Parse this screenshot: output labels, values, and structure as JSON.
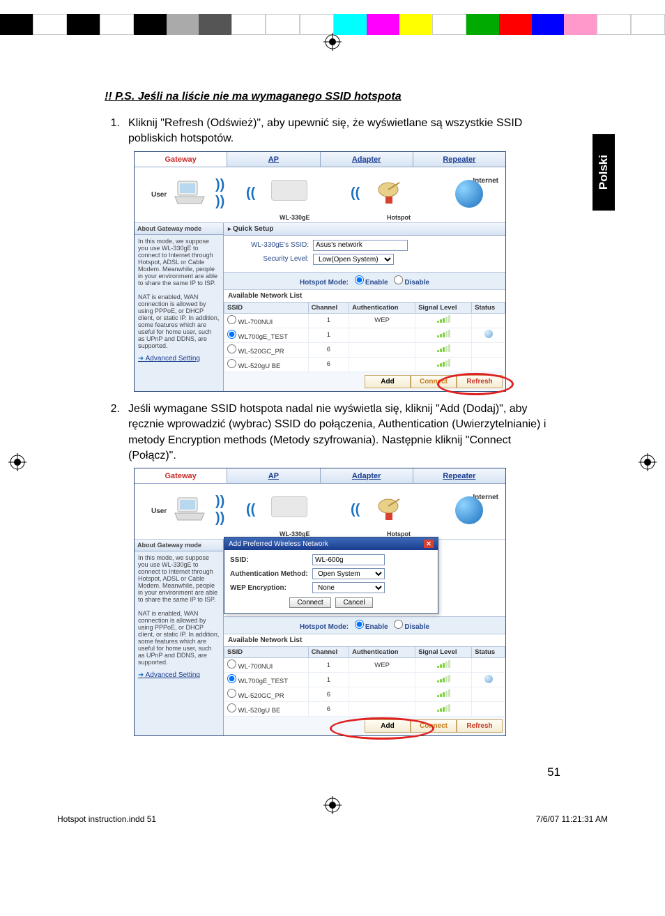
{
  "lang_tab": "Polski",
  "ps_heading": "!! P.S. Jeśli na liście nie ma wymaganego SSID hotspota",
  "steps": [
    {
      "num": "1.",
      "text": "Kliknij \"Refresh (Odśwież)\", aby upewnić się, że wyświetlane są wszystkie SSID pobliskich hotspotów."
    },
    {
      "num": "2.",
      "text": "Jeśli wymagane SSID hotspota nadal nie wyświetla się, kliknij \"Add (Dodaj)\", aby ręcznie wprowadzić (wybrac) SSID do połączenia, Authentication (Uwierzytelnianie) i metody Encryption methods (Metody szyfrowania). Następnie kliknij \"Connect (Połącz)\"."
    }
  ],
  "tabs": {
    "gateway": "Gateway",
    "ap": "AP",
    "adapter": "Adapter",
    "repeater": "Repeater"
  },
  "diagram": {
    "user": "User",
    "internet": "Internet",
    "device": "WL-330gE",
    "hotspot": "Hotspot"
  },
  "sidebar": {
    "title": "About Gateway mode",
    "text1": "In this mode, we suppose you use WL-330gE to connect to Internet through Hotspot, ADSL or Cable Modem. Meanwhile, people in your environment are able to share the same IP to ISP.",
    "text2": "NAT is enabled, WAN connection is allowed by using PPPoE, or DHCP client, or static IP. In addition, some features which are useful for home user, such as UPnP and DDNS, are supported.",
    "link": "Advanced Setting"
  },
  "quick_setup": {
    "title": "Quick Setup",
    "ssid_label": "WL-330gE's SSID:",
    "ssid_value": "Asus's network",
    "security_label": "Security Level:",
    "security_value": "Low(Open System)"
  },
  "hotspot_mode": {
    "label": "Hotspot Mode:",
    "enable": "Enable",
    "disable": "Disable"
  },
  "network_list": {
    "title": "Available Network List",
    "headers": {
      "ssid": "SSID",
      "channel": "Channel",
      "auth": "Authentication",
      "signal": "Signal Level",
      "status": "Status"
    },
    "rows": [
      {
        "ssid": "WL-700NUI",
        "channel": "1",
        "auth": "WEP",
        "selected": false,
        "status": false
      },
      {
        "ssid": "WL700gE_TEST",
        "channel": "1",
        "auth": "",
        "selected": true,
        "status": true
      },
      {
        "ssid": "WL-520GC_PR",
        "channel": "6",
        "auth": "",
        "selected": false,
        "status": false
      },
      {
        "ssid": "WL-520gU BE",
        "channel": "6",
        "auth": "",
        "selected": false,
        "status": false
      }
    ]
  },
  "buttons": {
    "add": "Add",
    "connect": "Connect",
    "refresh": "Refresh"
  },
  "dialog": {
    "title": "Add Preferred Wireless Network",
    "ssid_label": "SSID:",
    "ssid_value": "WL-600g",
    "auth_label": "Authentication Method:",
    "auth_value": "Open System",
    "wep_label": "WEP Encryption:",
    "wep_value": "None",
    "connect": "Connect",
    "cancel": "Cancel"
  },
  "page_number": "51",
  "footer": {
    "file": "Hotspot instruction.indd   51",
    "date": "7/6/07   11:21:31 AM"
  }
}
